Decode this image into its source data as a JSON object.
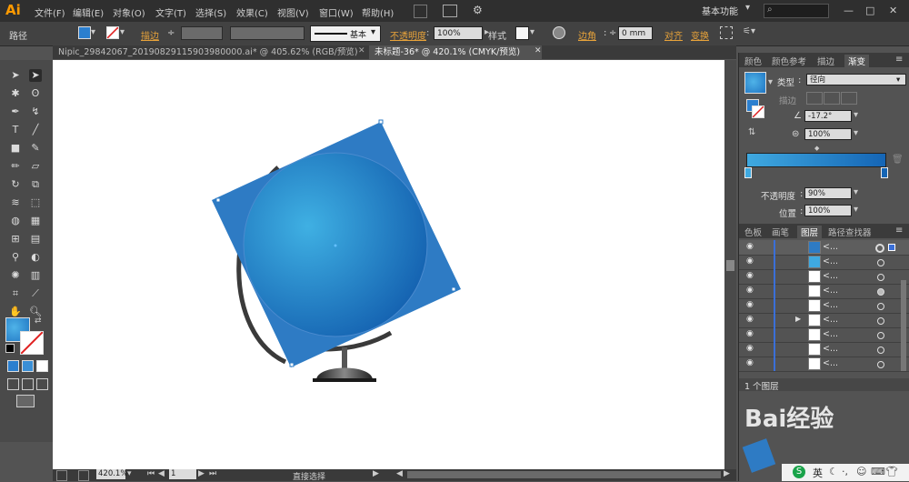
{
  "app": {
    "logo": "Ai",
    "menu": [
      "文件(F)",
      "编辑(E)",
      "对象(O)",
      "文字(T)",
      "选择(S)",
      "效果(C)",
      "视图(V)",
      "窗口(W)",
      "帮助(H)"
    ],
    "workspace": "基本功能",
    "window_controls": [
      "—",
      "□",
      "✕"
    ]
  },
  "control_bar": {
    "object_type": "路径",
    "stroke_label": "描边",
    "stroke_style": "基本",
    "opacity_label": "不透明度",
    "opacity_value": "100%",
    "style_label": "样式",
    "corner_label": "边角",
    "corner_value": "0 mm",
    "align_label": "对齐",
    "transform_label": "变换"
  },
  "tabs": [
    {
      "label": "Nipic_29842067_20190829115903980000.ai* @ 405.62% (RGB/预览)",
      "active": false
    },
    {
      "label": "未标题-36* @ 420.1% (CMYK/预览)",
      "active": true
    }
  ],
  "gradient_panel": {
    "tabs": [
      "颜色",
      "颜色参考",
      "描边",
      "渐变"
    ],
    "type_label": "类型",
    "type_value": "径向",
    "stroke_label": "描边",
    "angle_value": "-17.2°",
    "aspect_value": "100%",
    "opacity_label": "不透明度",
    "opacity_value": "90%",
    "location_label": "位置",
    "location_value": "100%",
    "colors": {
      "start": "#3fa9e0",
      "end": "#1565b5"
    }
  },
  "layers_panel": {
    "tabs": [
      "色板",
      "画笔",
      "图层",
      "路径查找器"
    ],
    "rows": [
      "<...",
      "<...",
      "<...",
      "<...",
      "<...",
      "<...",
      "<...",
      "<...",
      "<..."
    ],
    "footer": "1 个图层"
  },
  "status_bar": {
    "zoom": "420.1%",
    "page": "1",
    "tool": "直接选择"
  },
  "watermark": "Bai经验",
  "taskbar": {
    "ime": "英"
  }
}
